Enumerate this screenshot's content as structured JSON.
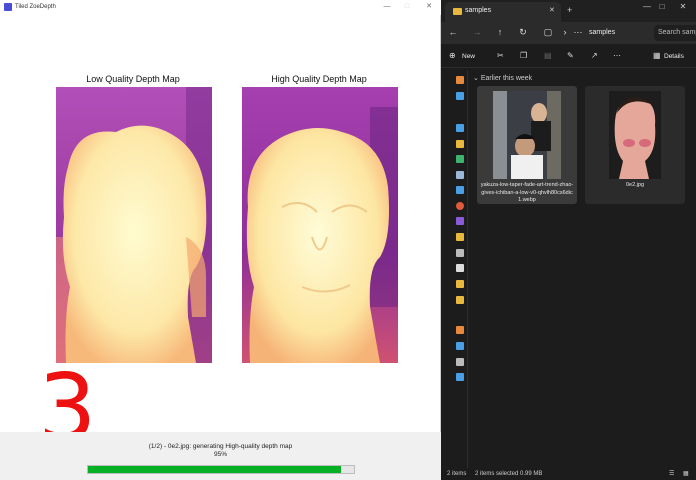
{
  "app": {
    "title": "Tiled ZoeDepth",
    "left_title": "Low Quality Depth Map",
    "right_title": "High Quality Depth Map",
    "overlay_number": "3",
    "status_message": "(1/2) - 0e2.jpg: generating High-quality depth map",
    "progress_text": "95%",
    "progress_fraction": 0.95,
    "progress_color": "#06b025",
    "window_controls": [
      "minimize-icon",
      "maximize-icon",
      "close-icon"
    ]
  },
  "explorer": {
    "tab_label": "samples",
    "address_label": "samples",
    "search_placeholder": "Search samples",
    "new_label": "New",
    "details_label": "Details",
    "section_header": "Earlier this week",
    "files": [
      {
        "name": "yakuza-low-taper-fade-art-trend-zhao-gives-ichiban-a-low-v0-qhvlh80cs6dic1.webp",
        "selected": true
      },
      {
        "name": "0e2.jpg",
        "selected": true
      }
    ],
    "status": {
      "items": "2 items",
      "selected": "2 items selected  0.99 MB"
    },
    "colors": {
      "folder": "#e8b93c",
      "accent": "#4aa0e6"
    }
  }
}
